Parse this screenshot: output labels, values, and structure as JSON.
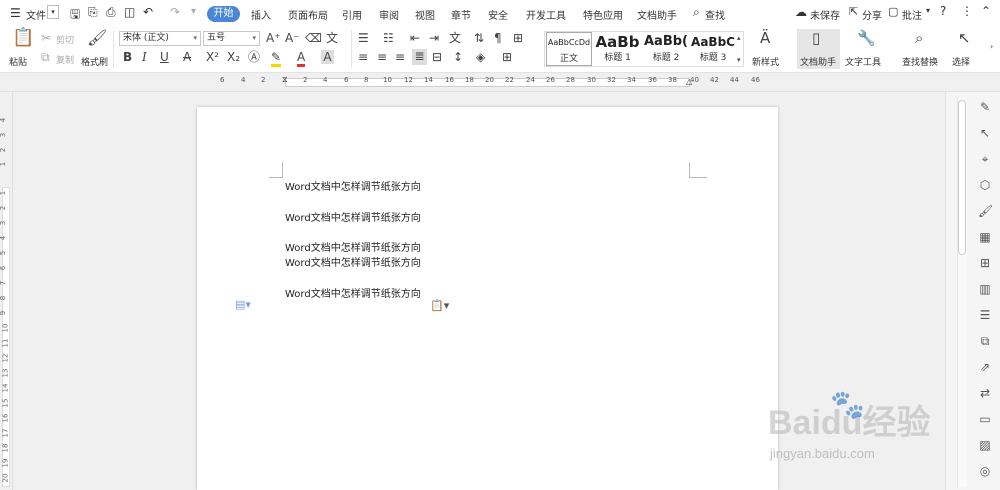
{
  "menu": {
    "file_label": "文件",
    "tabs": [
      "开始",
      "插入",
      "页面布局",
      "引用",
      "审阅",
      "视图",
      "章节",
      "安全",
      "开发工具",
      "特色应用",
      "文档助手"
    ],
    "search_label": "查找",
    "unsaved_label": "未保存",
    "share_label": "分享",
    "comment_label": "批注"
  },
  "ribbon": {
    "paste": "粘贴",
    "cut": "剪切",
    "copy": "复制",
    "format_painter": "格式刷",
    "font_name": "宋体 (正文)",
    "font_size": "五号",
    "styles": [
      {
        "preview": "AaBbCcDd",
        "name": "正文"
      },
      {
        "preview": "AaBb",
        "name": "标题 1"
      },
      {
        "preview": "AaBb(",
        "name": "标题 2"
      },
      {
        "preview": "AaBbC",
        "name": "标题 3"
      }
    ],
    "new_style": "新样式",
    "doc_assistant": "文档助手",
    "text_tools": "文字工具",
    "find_replace": "查找替换",
    "select": "选择"
  },
  "ruler": {
    "h_ticks": [
      "6",
      "4",
      "2",
      "2",
      "4",
      "6",
      "8",
      "10",
      "12",
      "14",
      "16",
      "18",
      "20",
      "22",
      "24",
      "26",
      "28",
      "30",
      "32",
      "34",
      "36",
      "38",
      "40",
      "42",
      "44",
      "46"
    ],
    "v_ticks": [
      "4",
      "3",
      "2",
      "1",
      "1",
      "2",
      "3",
      "4",
      "5",
      "6",
      "7",
      "8",
      "9",
      "10",
      "11",
      "12",
      "13",
      "14",
      "15",
      "16",
      "17",
      "18",
      "19",
      "20"
    ]
  },
  "document": {
    "lines": [
      "Word文档中怎样调节纸张方向",
      "Word文档中怎样调节纸张方向",
      "Word文档中怎样调节纸张方向",
      "Word文档中怎样调节纸张方向",
      "Word文档中怎样调节纸张方向"
    ]
  },
  "watermark": {
    "brand": "Baidu经验",
    "url": "jingyan.baidu.com"
  },
  "colors": {
    "accent": "#4a87d9",
    "font_color": "#d33",
    "highlight": "#f5d800"
  }
}
